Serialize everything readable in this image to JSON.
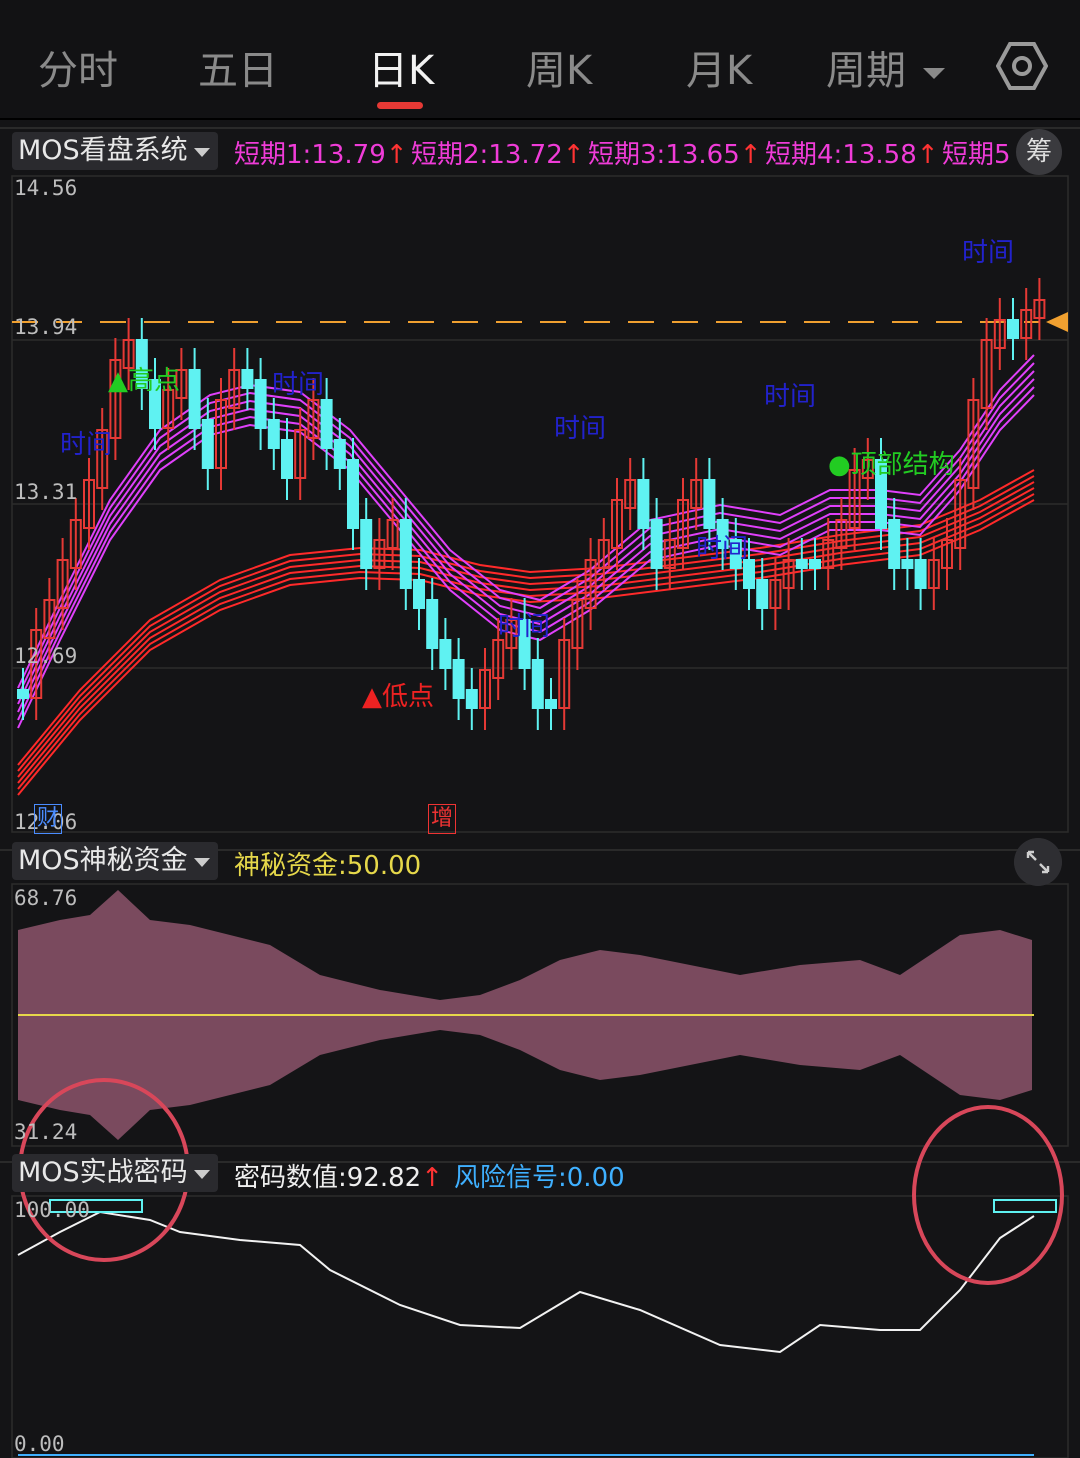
{
  "tabs": [
    "分时",
    "五日",
    "日K",
    "周K",
    "月K",
    "周期"
  ],
  "active_tab": "日K",
  "accent_color": "#e53935",
  "main_panel": {
    "selector_label": "MOS看盘系统",
    "chips_label": "筹",
    "indicators": [
      {
        "label": "短期1:",
        "value": "13.79",
        "arrow": "↑"
      },
      {
        "label": "短期2:",
        "value": "13.72",
        "arrow": "↑"
      },
      {
        "label": "短期3:",
        "value": "13.65",
        "arrow": "↑"
      },
      {
        "label": "短期4:",
        "value": "13.58",
        "arrow": "↑"
      },
      {
        "label": "短期5",
        "value": "",
        "arrow": ""
      }
    ],
    "y_ticks": [
      "14.56",
      "13.94",
      "13.31",
      "12.69",
      "12.06"
    ],
    "dashed_price": "13.94",
    "annotations": {
      "high_point": "▲高点",
      "low_point": "▲低点",
      "top_structure": "●顶部结构",
      "time": "时间"
    },
    "badges": {
      "finance": "财",
      "increase": "增"
    },
    "colors": {
      "up": "#e53935",
      "down": "#5ff2f2",
      "short_ma": "#e040fb",
      "long_ma": "#ff2a2a",
      "dashed": "#f0a030"
    }
  },
  "fund_panel": {
    "selector_label": "MOS神秘资金",
    "indicator_label": "神秘资金:",
    "indicator_value": "50.00",
    "y_top": "68.76",
    "y_bottom": "31.24",
    "fill_color": "#7a4a5e",
    "mid_color": "#e6d84a"
  },
  "code_panel": {
    "selector_label": "MOS实战密码",
    "value_label": "密码数值:",
    "value": "92.82",
    "value_arrow": "↑",
    "risk_label": "风险信号:",
    "risk_value": "0.00",
    "y_top": "100.00",
    "y_bottom": "0.00"
  }
}
